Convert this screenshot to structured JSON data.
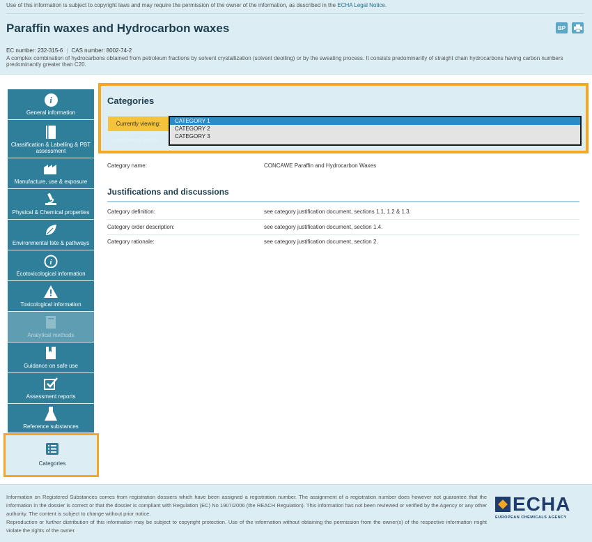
{
  "header": {
    "notice_prefix": "Use of this information is subject to copyright laws and may require the permission of the owner of the information, as described in the",
    "notice_link": "ECHA Legal Notice",
    "notice_suffix": ".",
    "title": "Paraffin waxes and Hydrocarbon waxes",
    "ec_number": "EC number: 232-315-6",
    "cas_number": "CAS number: 8002-74-2",
    "description": "A complex combination of hydrocarbons obtained from petroleum fractions by solvent crystallization (solvent deoiling) or by the sweating process. It consists predominantly of straight chain hydrocarbons having carbon numbers predominantly greater than C20.",
    "icons": [
      {
        "name": "bp-icon",
        "label": "BP"
      },
      {
        "name": "print-icon",
        "label": ""
      }
    ]
  },
  "sidebar": {
    "items": [
      {
        "label": "General information",
        "icon": "info-icon"
      },
      {
        "label": "Classification & Labelling & PBT assessment",
        "icon": "book-icon"
      },
      {
        "label": "Manufacture, use & exposure",
        "icon": "factory-icon"
      },
      {
        "label": "Physical & Chemical properties",
        "icon": "microscope-icon"
      },
      {
        "label": "Environmental fate & pathways",
        "icon": "leaf-icon"
      },
      {
        "label": "Ecotoxicological information",
        "icon": "eco-icon"
      },
      {
        "label": "Toxicological information",
        "icon": "warning-icon"
      },
      {
        "label": "Analytical methods",
        "icon": "document-icon"
      },
      {
        "label": "Guidance on safe use",
        "icon": "bookmark-icon"
      },
      {
        "label": "Assessment reports",
        "icon": "checkbox-icon"
      },
      {
        "label": "Reference substances",
        "icon": "flask-icon"
      },
      {
        "label": "Categories",
        "icon": "list-icon"
      }
    ]
  },
  "categories": {
    "title": "Categories",
    "viewing_label": "Currently viewing:",
    "faded_label": "Justifications and dis",
    "options": [
      "CATEGORY 1",
      "CATEGORY 2",
      "CATEGORY 3"
    ],
    "category_name_label": "Category name:",
    "category_name_value": "CONCAWE Paraffin and Hydrocarbon Waxes"
  },
  "justifications": {
    "title": "Justifications and discussions",
    "rows": [
      {
        "label": "Category definition:",
        "value": "see category justification document, sections 1.1, 1.2 & 1.3."
      },
      {
        "label": "Category order description:",
        "value": "see category justification document, section 1.4."
      },
      {
        "label": "Category rationale:",
        "value": "see category justification document, section 2."
      }
    ]
  },
  "footer": {
    "line1": "Information on Registered Substances comes from registration dossiers which have been assigned a registration number. The assignment of a registration number does however not guarantee that the information in the dossier is correct or that the dossier is compliant with Regulation (EC) No 1907/2006 (the REACH Regulation). This information has not been reviewed or verified by the Agency or any other authority. The content is subject to change without prior notice.",
    "line2": "Reproduction or further distribution of this information may be subject to copyright protection. Use of the information without obtaining the permission from the owner(s) of the respective information might violate the rights of the owner.",
    "logo_word": "ECHA",
    "logo_sub": "EUROPEAN CHEMICALS AGENCY"
  }
}
